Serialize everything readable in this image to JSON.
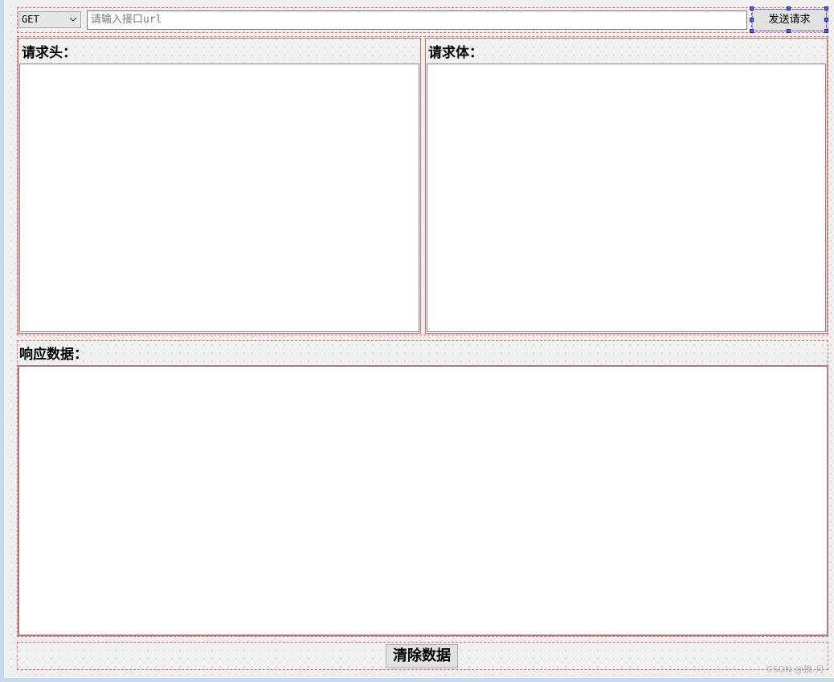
{
  "toolbar": {
    "method_value": "GET",
    "url_placeholder": "请输入接口url",
    "url_value": "",
    "send_label": "发送请求"
  },
  "panels": {
    "headers_label": "请求头：",
    "body_label": "请求体：",
    "response_label": "响应数据："
  },
  "footer": {
    "clear_label": "清除数据"
  },
  "watermark": "CSDN @摘-月",
  "colors": {
    "layout_border": "#e56b6b",
    "selection_handle": "#4a6cf0",
    "canvas_bg": "#f0f0f0",
    "window_edge": "#c7d9ef"
  }
}
